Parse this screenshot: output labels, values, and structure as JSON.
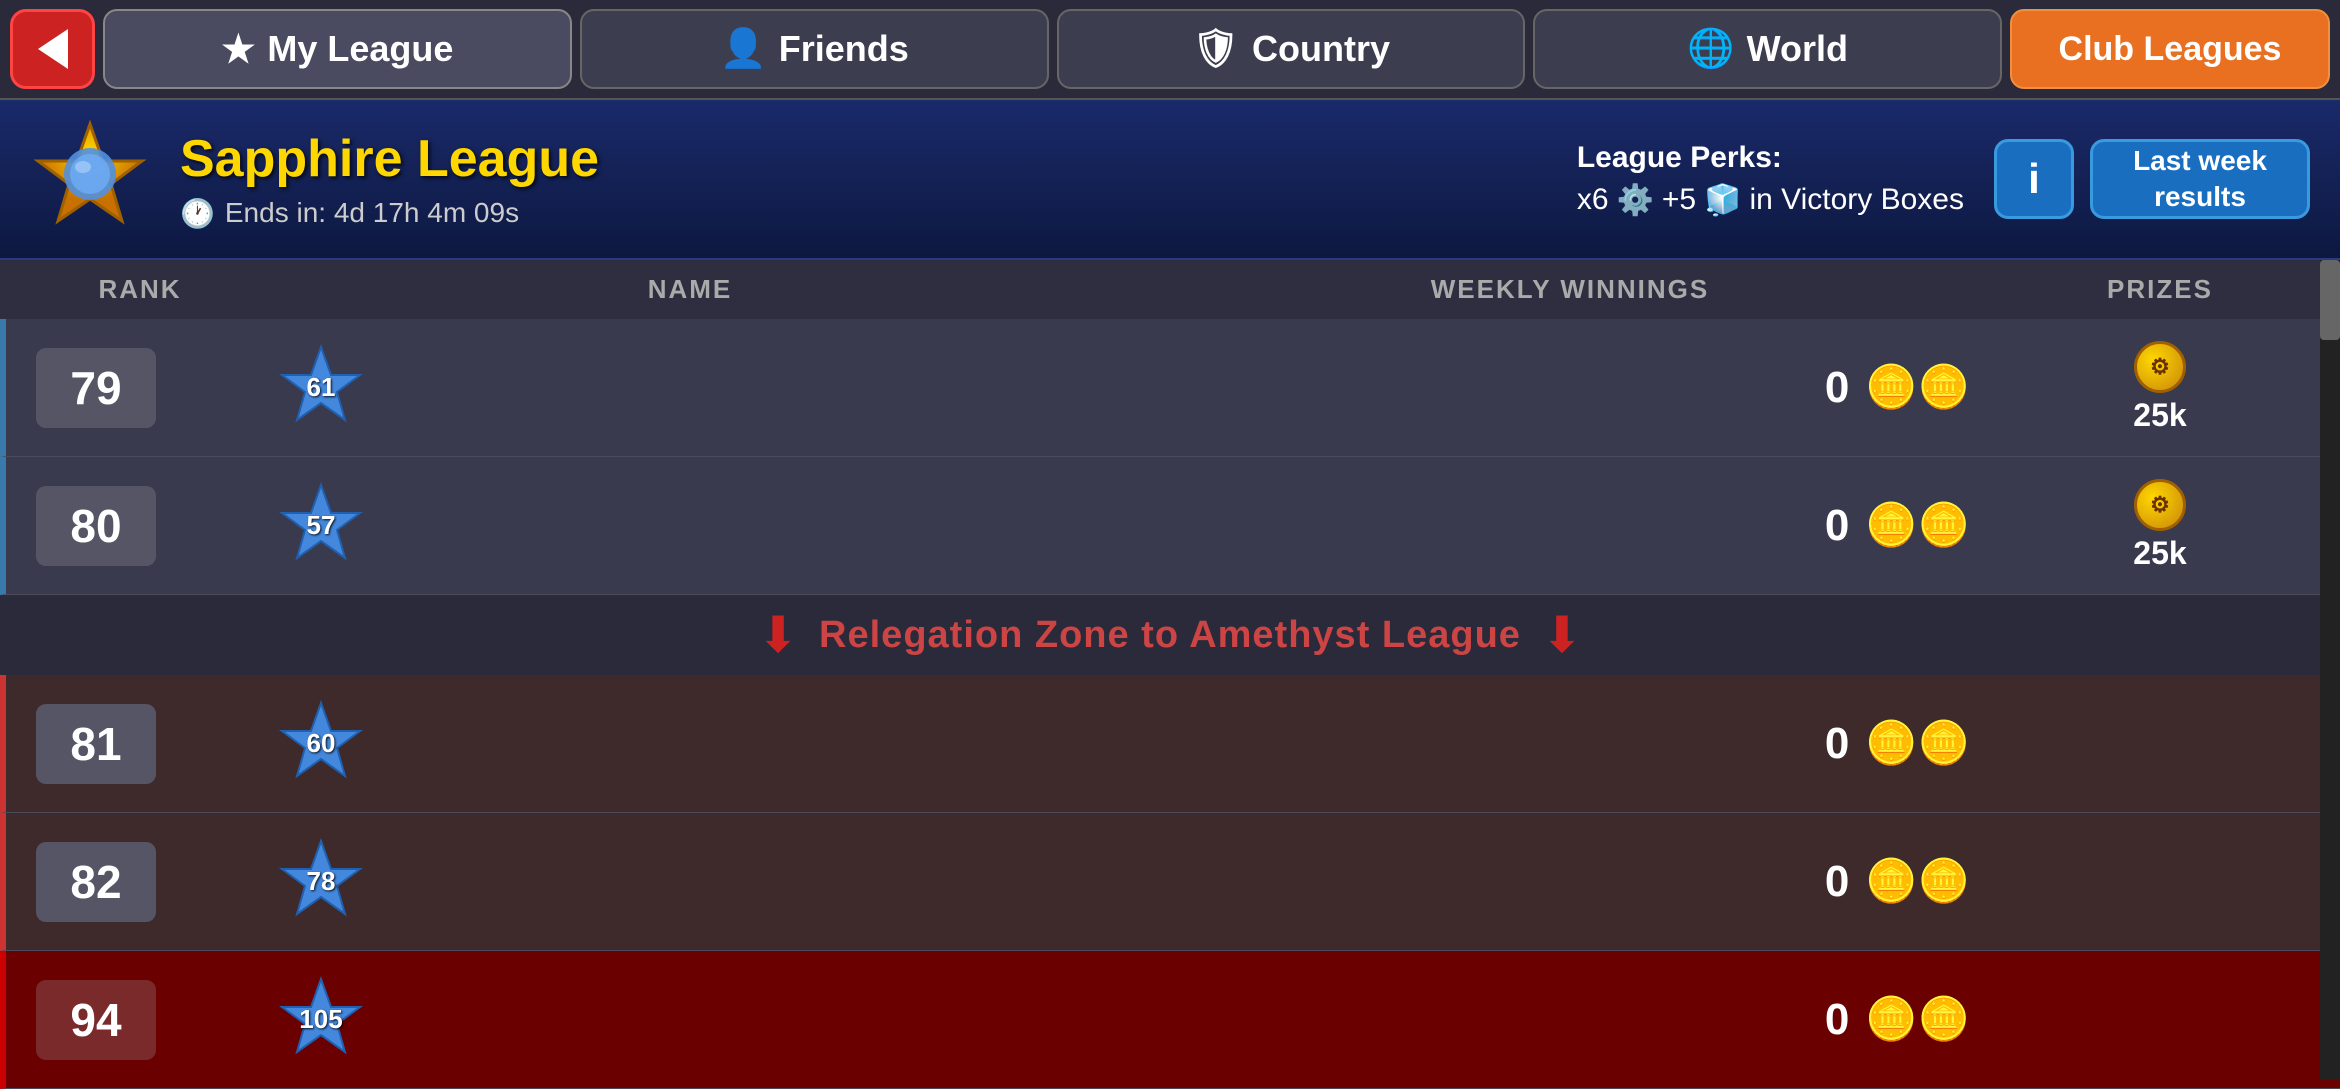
{
  "nav": {
    "back_label": "←",
    "tabs": [
      {
        "id": "my-league",
        "label": "My League",
        "icon": "★",
        "active": true
      },
      {
        "id": "friends",
        "label": "Friends",
        "icon": "👤"
      },
      {
        "id": "country",
        "label": "Country",
        "icon": "🛡"
      },
      {
        "id": "world",
        "label": "World",
        "icon": "🌐"
      }
    ],
    "club_leagues_label": "Club Leagues"
  },
  "league": {
    "name": "Sapphire League",
    "timer_label": "Ends in: 4d 17h 4m 09s",
    "perks_label": "League Perks:",
    "perks_value": "x6  +5  in Victory Boxes",
    "info_label": "i",
    "last_week_label": "Last week\nresults"
  },
  "table": {
    "headers": [
      "RANK",
      "NAME",
      "WEEKLY WINNINGS",
      "PRIZES"
    ],
    "rows": [
      {
        "rank": "79",
        "star_num": "61",
        "winnings": "0",
        "prize_value": "25k",
        "has_prize": true,
        "highlighted": false,
        "relegated": false
      },
      {
        "rank": "80",
        "star_num": "57",
        "winnings": "0",
        "prize_value": "25k",
        "has_prize": true,
        "highlighted": false,
        "relegated": false
      }
    ],
    "relegation_text": "Relegation Zone to Amethyst League",
    "relegated_rows": [
      {
        "rank": "81",
        "star_num": "60",
        "winnings": "0",
        "highlighted": false
      },
      {
        "rank": "82",
        "star_num": "78",
        "winnings": "0",
        "highlighted": false
      },
      {
        "rank": "94",
        "star_num": "105",
        "winnings": "0",
        "highlighted": true
      }
    ]
  }
}
